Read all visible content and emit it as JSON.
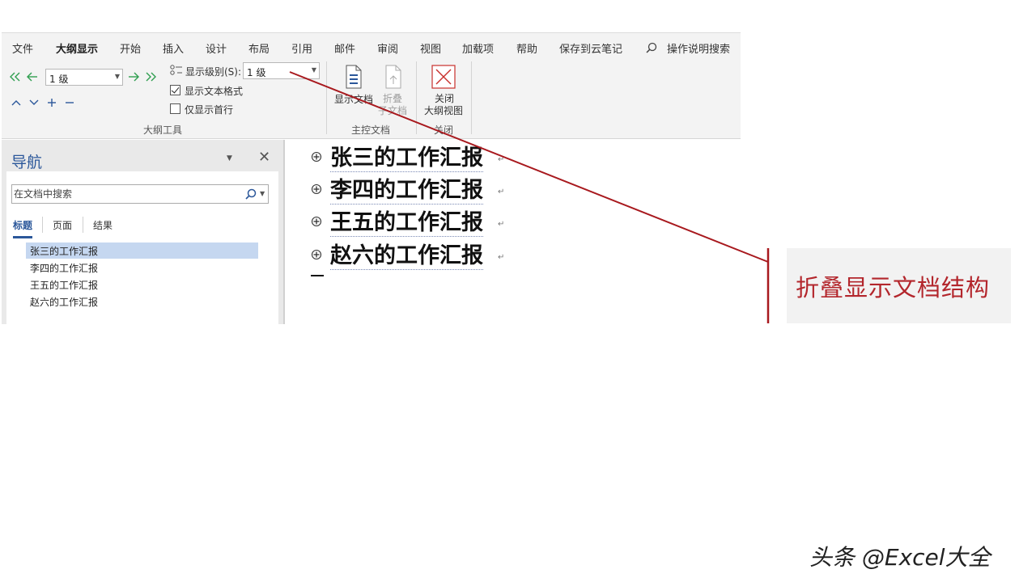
{
  "colors": {
    "accent": "#2b579a",
    "callout": "#b3262c",
    "selected": "#c5d7f0",
    "arrow_green": "#2e9e4f"
  },
  "tabs": [
    {
      "label": "文件"
    },
    {
      "label": "大纲显示",
      "active": true
    },
    {
      "label": "开始"
    },
    {
      "label": "插入"
    },
    {
      "label": "设计"
    },
    {
      "label": "布局"
    },
    {
      "label": "引用"
    },
    {
      "label": "邮件"
    },
    {
      "label": "审阅"
    },
    {
      "label": "视图"
    },
    {
      "label": "加载项"
    },
    {
      "label": "帮助"
    },
    {
      "label": "保存到云笔记"
    }
  ],
  "tell_me": {
    "label": "操作说明搜索",
    "icon": "search-icon"
  },
  "ribbon": {
    "outline_tools": {
      "label": "大纲工具",
      "level_value": "1 级",
      "show_level_label": "显示级别(S):",
      "show_level_value": "1 级",
      "show_text_format": {
        "label": "显示文本格式",
        "checked": true
      },
      "first_line_only": {
        "label": "仅显示首行",
        "checked": false
      }
    },
    "master_document": {
      "label": "主控文档",
      "show_document": "显示文档",
      "collapse_line1": "折叠",
      "collapse_line2": "子文档"
    },
    "close": {
      "label": "关闭",
      "close_line1": "关闭",
      "close_line2": "大纲视图"
    }
  },
  "navigation": {
    "title": "导航",
    "search_placeholder": "在文档中搜索",
    "tabs": [
      {
        "label": "标题",
        "active": true
      },
      {
        "label": "页面"
      },
      {
        "label": "结果"
      }
    ],
    "headings": [
      {
        "label": "张三的工作汇报",
        "selected": true
      },
      {
        "label": "李四的工作汇报"
      },
      {
        "label": "王五的工作汇报"
      },
      {
        "label": "赵六的工作汇报"
      }
    ]
  },
  "document": {
    "outline_items": [
      {
        "text": "张三的工作汇报"
      },
      {
        "text": "李四的工作汇报"
      },
      {
        "text": "王五的工作汇报"
      },
      {
        "text": "赵六的工作汇报"
      }
    ]
  },
  "annotation": {
    "text": "折叠显示文档结构"
  },
  "watermark": "头条 @Excel大全"
}
